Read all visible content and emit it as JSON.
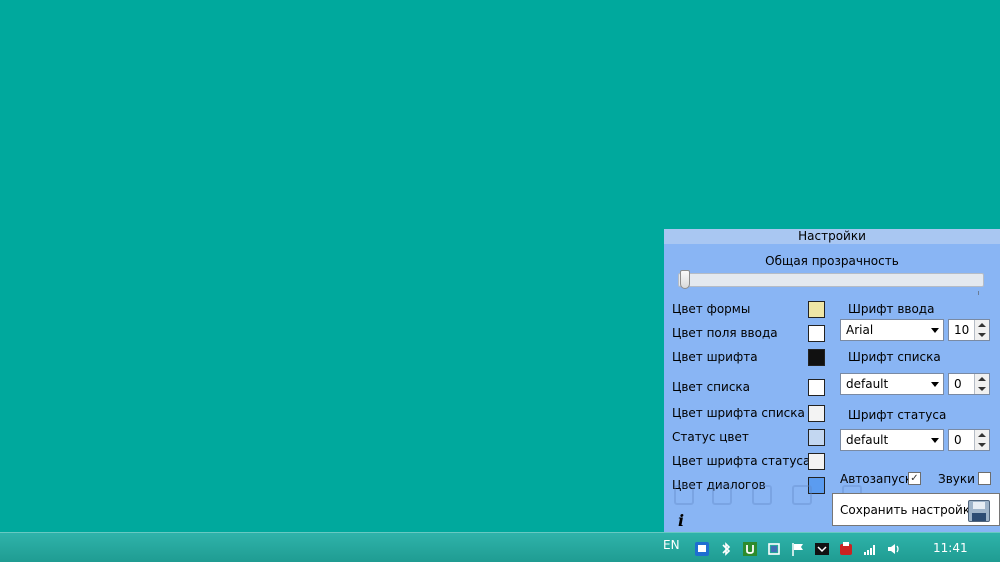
{
  "panel": {
    "title": "Настройки",
    "opacity_label": "Общая прозрачность",
    "opacity_value": 0.0,
    "colors": [
      {
        "label": "Цвет формы",
        "color": "#efe6a6"
      },
      {
        "label": "Цвет поля ввода",
        "color": "#ffffff"
      },
      {
        "label": "Цвет шрифта",
        "color": "#111111"
      },
      {
        "label": "Цвет списка",
        "color": "#ffffff"
      },
      {
        "label": "Цвет шрифта списка",
        "color": "#f3f3f3"
      },
      {
        "label": "Статус цвет",
        "color": "#c3d7f1"
      },
      {
        "label": "Цвет шрифта статуса",
        "color": "#f3f3f3"
      },
      {
        "label": "Цвет диалогов",
        "color": "#5b9cf0"
      }
    ],
    "fonts": {
      "input": {
        "label": "Шрифт ввода",
        "family": "Arial",
        "size": "10"
      },
      "list": {
        "label": "Шрифт списка",
        "family": "default",
        "size": "0"
      },
      "status": {
        "label": "Шрифт статуса",
        "family": "default",
        "size": "0"
      }
    },
    "autostart": {
      "label": "Автозапуск",
      "checked": true,
      "mark": "✓"
    },
    "sounds": {
      "label": "Звуки",
      "checked": false,
      "mark": ""
    },
    "info_symbol": "i"
  },
  "tooltip": {
    "text": "Сохранить настройки"
  },
  "taskbar": {
    "language": "EN",
    "clock": "11:41",
    "tray_icons": [
      "remote-desktop-icon",
      "bluetooth-icon",
      "utorrent-icon",
      "usb-device-icon",
      "action-center-flag-icon",
      "app-window-icon",
      "antivirus-icon",
      "network-signal-icon",
      "volume-icon"
    ]
  },
  "colors": {
    "desktop": "#00a99d",
    "panel": "#89b5f4",
    "panel_title": "#a9c7f2"
  }
}
